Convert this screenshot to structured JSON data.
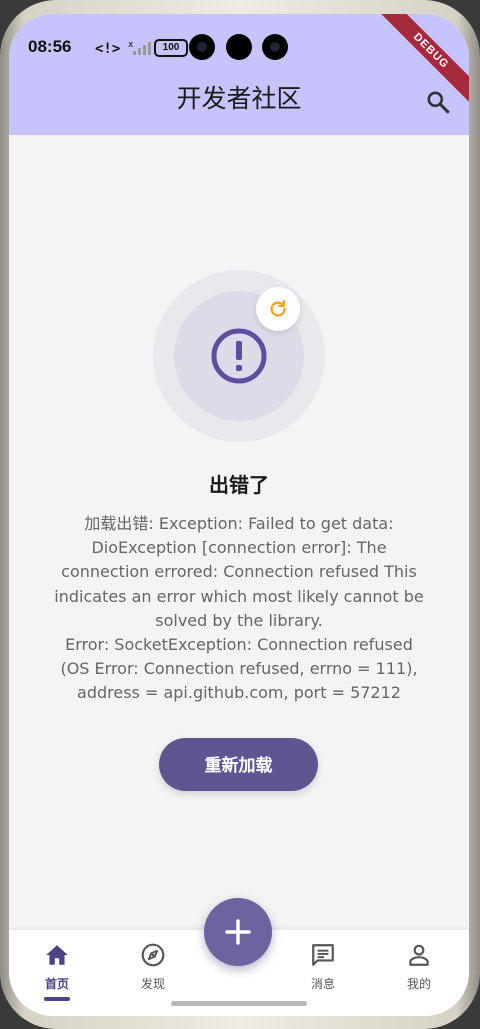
{
  "status_bar": {
    "time": "08:56",
    "battery": "100"
  },
  "debug_banner": "DEBUG",
  "app_bar": {
    "title": "开发者社区",
    "search_icon": "search-icon"
  },
  "error_state": {
    "illustration_icon": "alert-circle-icon",
    "badge_icon": "refresh-icon",
    "title": "出错了",
    "message": "加载出错: Exception: Failed to get data:\nDioException [connection error]: The\nconnection errored: Connection refused This\nindicates an error which most likely cannot be\nsolved by the library.\nError: SocketException: Connection refused\n(OS Error: Connection refused, errno = 111),\naddress = api.github.com, port = 57212",
    "reload_label": "重新加载"
  },
  "bottom_nav": {
    "items": [
      {
        "label": "首页",
        "icon": "home-icon",
        "active": true
      },
      {
        "label": "发现",
        "icon": "compass-icon",
        "active": false
      },
      {
        "label": "消息",
        "icon": "chat-icon",
        "active": false
      },
      {
        "label": "我的",
        "icon": "person-icon",
        "active": false
      }
    ],
    "fab_icon": "plus-icon"
  },
  "colors": {
    "app_bar": "#c7c4fd",
    "primary": "#5f5591",
    "fab": "#6d639f",
    "accent_orange": "#f5a623",
    "background": "#f4f4f4"
  }
}
